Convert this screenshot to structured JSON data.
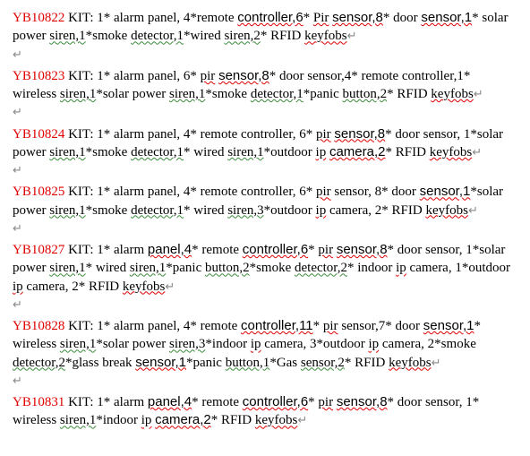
{
  "kits": [
    {
      "code": "YB10822",
      "text": " KIT: 1* alarm panel, 4*remote controller,6* Pir sensor,8* door sensor,1* solar power siren,1*smoke detector,1*wired siren,2* RFID keyfobs"
    },
    {
      "code": "YB10823",
      "text": " KIT:  1* alarm panel, 6* pir sensor,8* door sensor,4* remote controller,1* wireless siren,1*solar power siren,1*smoke detector,1*panic button,2* RFID keyfobs"
    },
    {
      "code": "YB10824",
      "text": " KIT:  1* alarm panel, 4* remote controller, 6* pir sensor,8* door sensor, 1*solar power siren,1*smoke detector,1* wired siren,1*outdoor ip camera,2* RFID keyfobs"
    },
    {
      "code": "YB10825",
      "text": " KIT: 1* alarm panel, 4* remote controller, 6* pir sensor, 8* door sensor,1*solar power siren,1*smoke detector,1* wired siren,3*outdoor ip camera, 2* RFID keyfobs"
    },
    {
      "code": "YB10827",
      "text": " KIT:  1* alarm panel,4* remote controller,6* pir sensor,8* door sensor, 1*solar power siren,1* wired siren,1*panic button,2*smoke detector,2* indoor ip camera, 1*outdoor ip camera, 2* RFID keyfobs"
    },
    {
      "code": "YB10828",
      "text": " KIT: 1* alarm panel, 4* remote controller,11* pir sensor,7* door sensor,1* wireless siren,1*solar power siren,3*indoor ip camera, 3*outdoor ip camera, 2*smoke detector,2*glass break sensor,1*panic button,1*Gas sensor,2* RFID keyfobs"
    },
    {
      "code": "YB10831",
      "text": " KIT: 1* alarm panel,4* remote controller,6* pir sensor,8* door sensor, 1* wireless siren,1*indoor ip camera,2* RFID keyfobs"
    }
  ],
  "pmark": "↵"
}
